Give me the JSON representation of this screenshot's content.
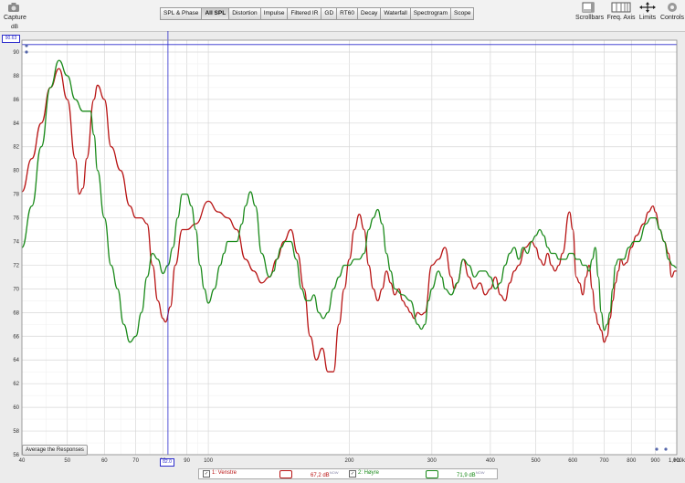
{
  "toolbar": {
    "capture_label": "Capture",
    "tabs": [
      "SPL & Phase",
      "All SPL",
      "Distortion",
      "Impulse",
      "Filtered IR",
      "GD",
      "RT60",
      "Decay",
      "Waterfall",
      "Spectrogram",
      "Scope"
    ],
    "active_tab": "All SPL",
    "right_tools": [
      "Scrollbars",
      "Freq. Axis",
      "Limits",
      "Controls"
    ]
  },
  "avg_button_label": "Average the Responses",
  "cursor": {
    "freq_label": "82.0",
    "level_label": "90.63"
  },
  "legend": {
    "items": [
      {
        "label": "1: Venstre",
        "level": "67,2 dB",
        "unit": "NOW",
        "checked": "✓"
      },
      {
        "label": "2: Høyre",
        "level": "71,9 dB",
        "unit": "NOW",
        "checked": "✓"
      }
    ]
  },
  "colors": {
    "series1": "#b81414",
    "series2": "#1a8a1a",
    "cursor": "#2c2ccc",
    "grid": "#d7d7d7",
    "plot_bg": "#ffffff"
  },
  "chart_data": {
    "type": "line",
    "xscale": "log",
    "xlim": [
      40,
      1000
    ],
    "ylim": [
      56,
      91
    ],
    "ylabel": "dB",
    "xlabel": "Hz",
    "x_ticks": [
      "40",
      "50",
      "60",
      "70",
      "80",
      "90",
      "100",
      "200",
      "300",
      "400",
      "500",
      "600",
      "700",
      "800",
      "900",
      "1,000k"
    ],
    "x_tick_values": [
      40,
      50,
      60,
      70,
      80,
      90,
      100,
      200,
      300,
      400,
      500,
      600,
      700,
      800,
      900,
      1000
    ],
    "y_ticks": [
      "56",
      "58",
      "60",
      "62",
      "64",
      "66",
      "68",
      "70",
      "72",
      "74",
      "76",
      "78",
      "80",
      "82",
      "84",
      "86",
      "88",
      "90"
    ],
    "y_tick_values": [
      56,
      58,
      60,
      62,
      64,
      66,
      68,
      70,
      72,
      74,
      76,
      78,
      80,
      82,
      84,
      86,
      88,
      90
    ],
    "cursor_x": 82,
    "series": [
      {
        "name": "1: Venstre",
        "points": [
          [
            40,
            78.2
          ],
          [
            42,
            81
          ],
          [
            44,
            84
          ],
          [
            46,
            87
          ],
          [
            48,
            88.6
          ],
          [
            50,
            86
          ],
          [
            52,
            81
          ],
          [
            53,
            78
          ],
          [
            54,
            78.5
          ],
          [
            55,
            81
          ],
          [
            57,
            86
          ],
          [
            58,
            87.2
          ],
          [
            60,
            86
          ],
          [
            62,
            82
          ],
          [
            65,
            80
          ],
          [
            68,
            77
          ],
          [
            70,
            76
          ],
          [
            72,
            76
          ],
          [
            74,
            75.5
          ],
          [
            76,
            72
          ],
          [
            78,
            69
          ],
          [
            80,
            67.5
          ],
          [
            81,
            67.2
          ],
          [
            83,
            68.5
          ],
          [
            85,
            72
          ],
          [
            88,
            75
          ],
          [
            90,
            75
          ],
          [
            94,
            75.5
          ],
          [
            100,
            77.4
          ],
          [
            105,
            76.5
          ],
          [
            110,
            76
          ],
          [
            115,
            75
          ],
          [
            120,
            72.5
          ],
          [
            125,
            71.5
          ],
          [
            130,
            70.5
          ],
          [
            135,
            71
          ],
          [
            140,
            72.5
          ],
          [
            145,
            74
          ],
          [
            150,
            75
          ],
          [
            155,
            73
          ],
          [
            160,
            70
          ],
          [
            165,
            66
          ],
          [
            170,
            64
          ],
          [
            175,
            65
          ],
          [
            180,
            63
          ],
          [
            185,
            63
          ],
          [
            190,
            67
          ],
          [
            195,
            70
          ],
          [
            200,
            72.5
          ],
          [
            205,
            75
          ],
          [
            210,
            76.3
          ],
          [
            215,
            75
          ],
          [
            220,
            72
          ],
          [
            225,
            70
          ],
          [
            230,
            69
          ],
          [
            235,
            70
          ],
          [
            240,
            71.5
          ],
          [
            245,
            70.5
          ],
          [
            250,
            69.5
          ],
          [
            255,
            70
          ],
          [
            260,
            69
          ],
          [
            265,
            68.5
          ],
          [
            270,
            68
          ],
          [
            275,
            67.5
          ],
          [
            280,
            68
          ],
          [
            285,
            67.8
          ],
          [
            290,
            68
          ],
          [
            300,
            72
          ],
          [
            310,
            72.5
          ],
          [
            320,
            73.5
          ],
          [
            330,
            71
          ],
          [
            335,
            70
          ],
          [
            340,
            70.5
          ],
          [
            350,
            72.5
          ],
          [
            360,
            71
          ],
          [
            370,
            70
          ],
          [
            380,
            70.5
          ],
          [
            390,
            69.5
          ],
          [
            400,
            70
          ],
          [
            410,
            71
          ],
          [
            420,
            69.5
          ],
          [
            430,
            69
          ],
          [
            440,
            70.5
          ],
          [
            450,
            71.5
          ],
          [
            460,
            72
          ],
          [
            475,
            73.5
          ],
          [
            490,
            74
          ],
          [
            500,
            73.5
          ],
          [
            510,
            72.5
          ],
          [
            520,
            72
          ],
          [
            530,
            73
          ],
          [
            540,
            72
          ],
          [
            550,
            71.5
          ],
          [
            560,
            72
          ],
          [
            570,
            73
          ],
          [
            590,
            76.5
          ],
          [
            600,
            75
          ],
          [
            610,
            71
          ],
          [
            620,
            70.5
          ],
          [
            630,
            69.5
          ],
          [
            640,
            71
          ],
          [
            650,
            72
          ],
          [
            660,
            70
          ],
          [
            670,
            68
          ],
          [
            680,
            67
          ],
          [
            690,
            66.5
          ],
          [
            700,
            65.5
          ],
          [
            710,
            66
          ],
          [
            720,
            67.5
          ],
          [
            730,
            69
          ],
          [
            740,
            70.5
          ],
          [
            750,
            71.5
          ],
          [
            760,
            72.5
          ],
          [
            770,
            72
          ],
          [
            780,
            72.2
          ],
          [
            800,
            73.5
          ],
          [
            820,
            74.5
          ],
          [
            850,
            75.5
          ],
          [
            870,
            76.5
          ],
          [
            890,
            77
          ],
          [
            900,
            76.5
          ],
          [
            920,
            75
          ],
          [
            940,
            74
          ],
          [
            960,
            73
          ],
          [
            975,
            71
          ],
          [
            990,
            71.5
          ],
          [
            1000,
            71.5
          ]
        ]
      },
      {
        "name": "2: Høyre",
        "points": [
          [
            40,
            73.5
          ],
          [
            42,
            77
          ],
          [
            44,
            82
          ],
          [
            46,
            87
          ],
          [
            48,
            89.3
          ],
          [
            50,
            88
          ],
          [
            52,
            86
          ],
          [
            54,
            85
          ],
          [
            56,
            85
          ],
          [
            57,
            83
          ],
          [
            58,
            80
          ],
          [
            60,
            76
          ],
          [
            62,
            72
          ],
          [
            64,
            70
          ],
          [
            66,
            67
          ],
          [
            68,
            65.5
          ],
          [
            70,
            66
          ],
          [
            72,
            68
          ],
          [
            74,
            71
          ],
          [
            76,
            73
          ],
          [
            78,
            72.5
          ],
          [
            80,
            71.3
          ],
          [
            82,
            72
          ],
          [
            84,
            73.5
          ],
          [
            86,
            76
          ],
          [
            88,
            78
          ],
          [
            90,
            78
          ],
          [
            92,
            77
          ],
          [
            94,
            75
          ],
          [
            96,
            72
          ],
          [
            98,
            70
          ],
          [
            100,
            68.8
          ],
          [
            103,
            70
          ],
          [
            106,
            72
          ],
          [
            108,
            73
          ],
          [
            110,
            74
          ],
          [
            115,
            74
          ],
          [
            118,
            75.5
          ],
          [
            120,
            77
          ],
          [
            123,
            78.2
          ],
          [
            126,
            77
          ],
          [
            130,
            73
          ],
          [
            135,
            71
          ],
          [
            138,
            71.5
          ],
          [
            140,
            72.5
          ],
          [
            143,
            73.5
          ],
          [
            146,
            74
          ],
          [
            150,
            74
          ],
          [
            154,
            72.5
          ],
          [
            158,
            70
          ],
          [
            162,
            69
          ],
          [
            165,
            69
          ],
          [
            168,
            69.5
          ],
          [
            172,
            68
          ],
          [
            176,
            67.5
          ],
          [
            180,
            68
          ],
          [
            185,
            70
          ],
          [
            190,
            71
          ],
          [
            195,
            72
          ],
          [
            200,
            72
          ],
          [
            205,
            72.5
          ],
          [
            210,
            72.5
          ],
          [
            215,
            73
          ],
          [
            220,
            75
          ],
          [
            225,
            76
          ],
          [
            230,
            76.7
          ],
          [
            235,
            75.5
          ],
          [
            240,
            73
          ],
          [
            245,
            71.5
          ],
          [
            250,
            70
          ],
          [
            260,
            69.5
          ],
          [
            270,
            69
          ],
          [
            280,
            67
          ],
          [
            285,
            66.6
          ],
          [
            290,
            67
          ],
          [
            295,
            69
          ],
          [
            300,
            70
          ],
          [
            310,
            71.5
          ],
          [
            315,
            71
          ],
          [
            320,
            70
          ],
          [
            330,
            69.5
          ],
          [
            340,
            70.5
          ],
          [
            350,
            72.5
          ],
          [
            360,
            72
          ],
          [
            370,
            71
          ],
          [
            380,
            71.5
          ],
          [
            390,
            71.5
          ],
          [
            400,
            71
          ],
          [
            410,
            70
          ],
          [
            420,
            70.5
          ],
          [
            430,
            72
          ],
          [
            440,
            73
          ],
          [
            450,
            73.5
          ],
          [
            460,
            72.5
          ],
          [
            470,
            73.5
          ],
          [
            480,
            73
          ],
          [
            490,
            74
          ],
          [
            500,
            74.5
          ],
          [
            510,
            75
          ],
          [
            520,
            74.5
          ],
          [
            530,
            73.5
          ],
          [
            540,
            73
          ],
          [
            550,
            73
          ],
          [
            560,
            72.5
          ],
          [
            570,
            72.5
          ],
          [
            580,
            72.5
          ],
          [
            590,
            73
          ],
          [
            600,
            73
          ],
          [
            610,
            72.5
          ],
          [
            620,
            72.5
          ],
          [
            630,
            72
          ],
          [
            640,
            72
          ],
          [
            650,
            71.5
          ],
          [
            660,
            72.5
          ],
          [
            670,
            73.5
          ],
          [
            680,
            71
          ],
          [
            690,
            68
          ],
          [
            700,
            66.5
          ],
          [
            710,
            67
          ],
          [
            720,
            68
          ],
          [
            730,
            70
          ],
          [
            740,
            72
          ],
          [
            750,
            72.5
          ],
          [
            770,
            72.5
          ],
          [
            790,
            73.5
          ],
          [
            810,
            74
          ],
          [
            830,
            74
          ],
          [
            860,
            75.5
          ],
          [
            880,
            76
          ],
          [
            900,
            76
          ],
          [
            920,
            75
          ],
          [
            940,
            74
          ],
          [
            960,
            72.5
          ],
          [
            980,
            72
          ],
          [
            1000,
            71.8
          ]
        ]
      }
    ]
  }
}
